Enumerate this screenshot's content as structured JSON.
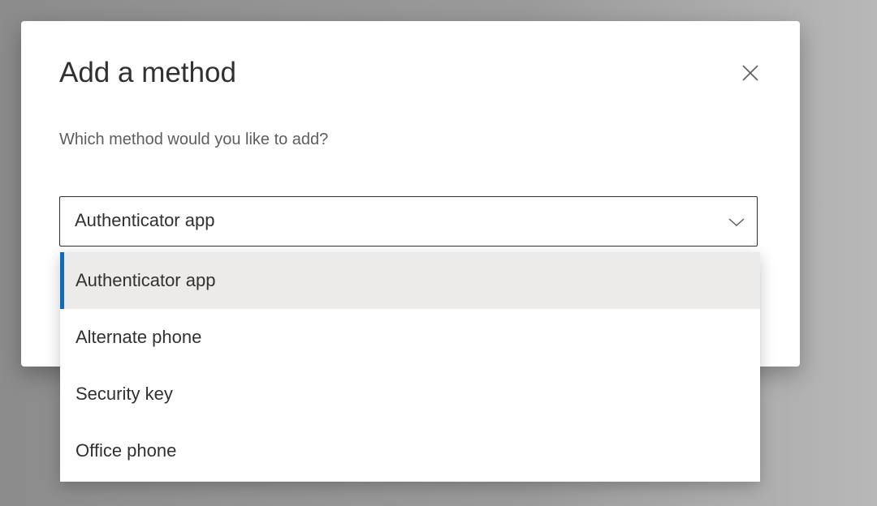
{
  "dialog": {
    "title": "Add a method",
    "question": "Which method would you like to add?",
    "close_icon": "close-icon"
  },
  "method_select": {
    "selected_value": "Authenticator app",
    "chevron_icon": "chevron-down-icon"
  },
  "dropdown": {
    "options": [
      {
        "label": "Authenticator app",
        "selected": true
      },
      {
        "label": "Alternate phone",
        "selected": false
      },
      {
        "label": "Security key",
        "selected": false
      },
      {
        "label": "Office phone",
        "selected": false
      }
    ],
    "accent_color": "#0f6cbd"
  }
}
